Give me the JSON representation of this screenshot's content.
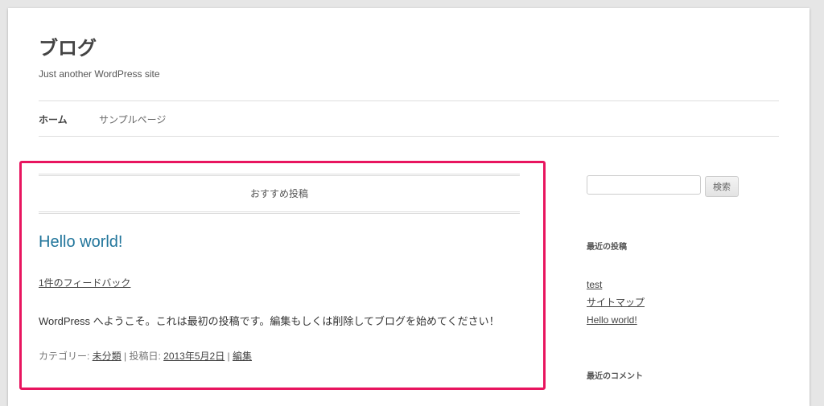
{
  "site": {
    "title": "ブログ",
    "description": "Just another WordPress site"
  },
  "nav": {
    "items": [
      {
        "label": "ホーム",
        "current": true
      },
      {
        "label": "サンプルページ",
        "current": false
      }
    ]
  },
  "featured": {
    "label": "おすすめ投稿"
  },
  "post": {
    "title": "Hello world!",
    "comments_link": "1件のフィードバック",
    "content": "WordPress へようこそ。これは最初の投稿です。編集もしくは削除してブログを始めてください！",
    "meta": {
      "category_prefix": "カテゴリー: ",
      "category": "未分類",
      "separator1": " | ",
      "date_prefix": "投稿日: ",
      "date": "2013年5月2日",
      "separator2": " | ",
      "edit": "編集"
    }
  },
  "sidebar": {
    "search": {
      "value": "",
      "button_label": "検索"
    },
    "recent_posts": {
      "title": "最近の投稿",
      "items": [
        "test",
        "サイトマップ",
        "Hello world!"
      ]
    },
    "recent_comments": {
      "title": "最近のコメント"
    }
  },
  "colors": {
    "highlight": "#e8155f",
    "link": "#21759b"
  }
}
